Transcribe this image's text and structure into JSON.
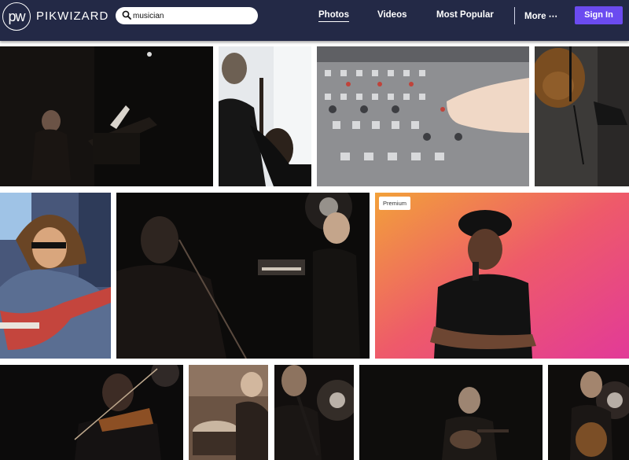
{
  "header": {
    "logo_mark": "pw",
    "logo_word": "PIKWIZARD",
    "search": {
      "value": "musician",
      "icon": "search-icon"
    },
    "nav": [
      {
        "label": "Photos",
        "active": true
      },
      {
        "label": "Videos",
        "active": false
      },
      {
        "label": "Most Popular",
        "active": false
      },
      {
        "label": "More ⋯",
        "active": false
      }
    ],
    "sign_in_label": "Sign In"
  },
  "colors": {
    "topbar": "#232946",
    "accent": "#6b4bf0"
  },
  "gallery": {
    "premium_badge": "Premium"
  }
}
